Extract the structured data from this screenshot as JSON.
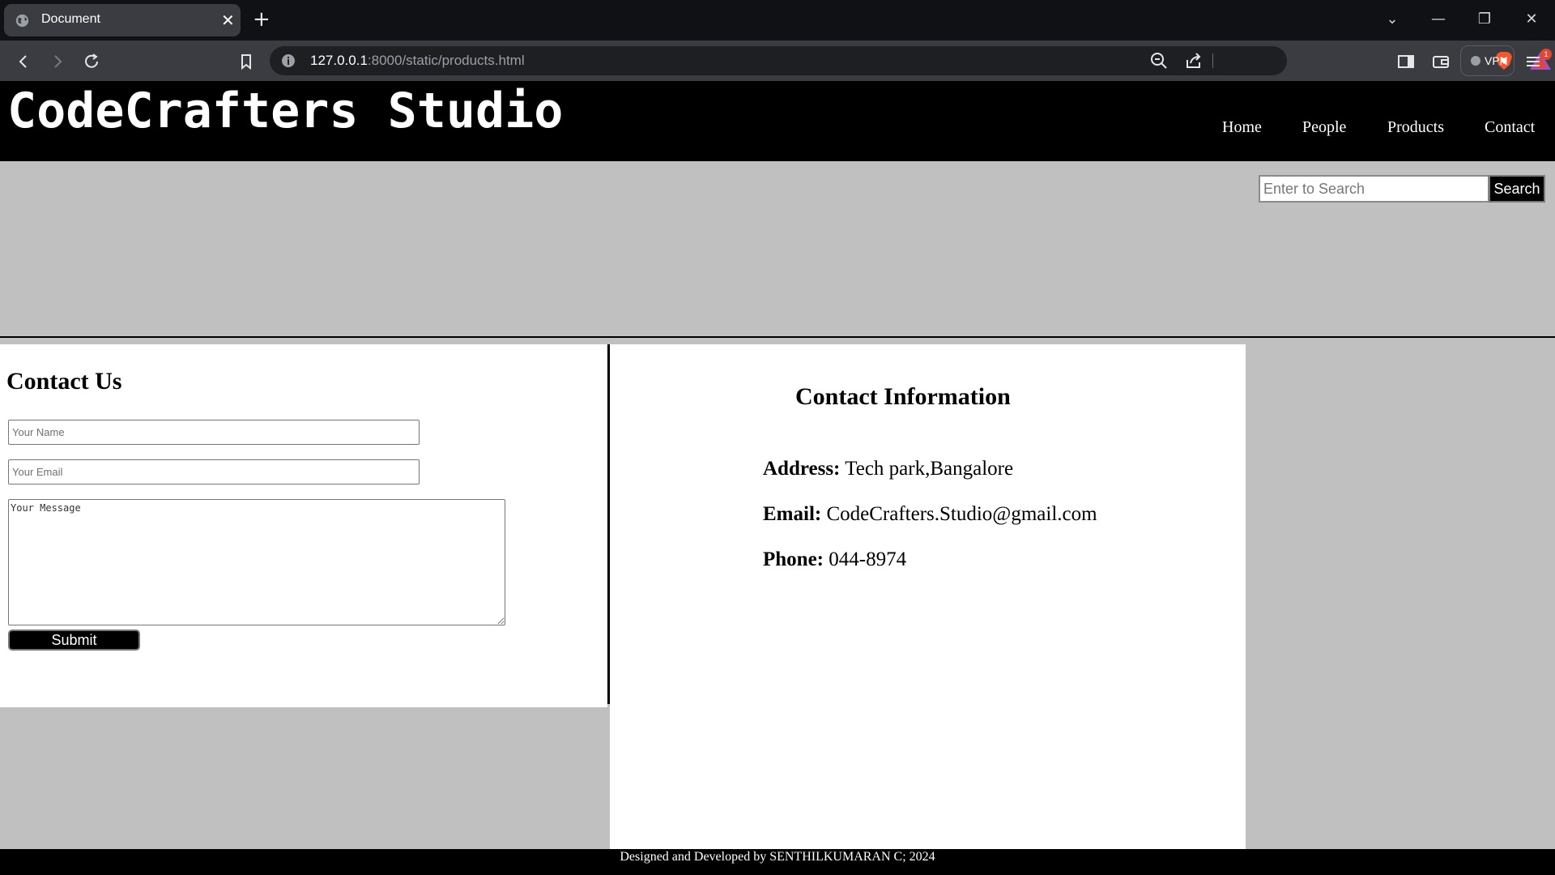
{
  "browser": {
    "tab_title": "Document",
    "tab_close": "✕",
    "new_tab": "+",
    "url_host": "127.0.0.1",
    "url_rest": ":8000/static/products.html",
    "vpn_label": "VPN",
    "rewards_badge": "1",
    "window_controls": {
      "menu": "⌄",
      "minimize": "—",
      "restore": "❐",
      "close": "✕"
    }
  },
  "header": {
    "brand": "CodeCrafters Studio",
    "nav": [
      {
        "label": "Home"
      },
      {
        "label": "People"
      },
      {
        "label": "Products"
      },
      {
        "label": "Contact"
      }
    ]
  },
  "search": {
    "placeholder": "Enter to Search",
    "button": "Search"
  },
  "contact_form": {
    "title": "Contact Us",
    "name_placeholder": "Your Name",
    "email_placeholder": "Your Email",
    "message_placeholder": "Your Message",
    "submit": "Submit"
  },
  "contact_info": {
    "title": "Contact Information",
    "address_label": "Address:",
    "address_value": "Tech park,Bangalore",
    "email_label": "Email:",
    "email_value": "CodeCrafters.Studio@gmail.com",
    "phone_label": "Phone:",
    "phone_value": "044-8974"
  },
  "footer": {
    "text": "Designed and Developed by SENTHILKUMARAN C; 2024"
  },
  "colors": {
    "page_background": "#c0c0c0",
    "header_background": "#000000",
    "panel_background": "#ffffff",
    "browser_frame": "#0f1115",
    "browser_toolbar": "#3a3c41"
  }
}
